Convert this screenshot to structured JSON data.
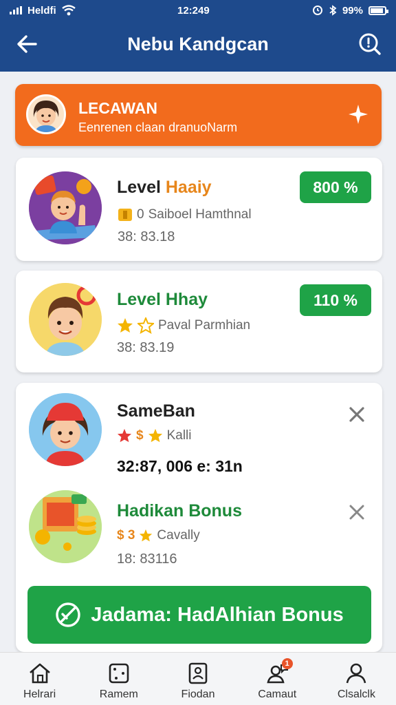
{
  "status_bar": {
    "carrier": "Heldfi",
    "time": "12:249",
    "battery": "99%"
  },
  "header": {
    "title": "Nebu Kandgcan"
  },
  "banner": {
    "title": "LECAWAN",
    "subtitle": "Eenrenen claan dranuoNarm"
  },
  "cards": [
    {
      "title_plain": "Level ",
      "title_accent": "Haaiy",
      "subtitle": "Saiboel Hamthnal",
      "subtitle_icon_text": "0",
      "time": "38: 83.18",
      "percent": "800 %"
    },
    {
      "title": "Level Hhay",
      "subtitle": "Paval Parmhian",
      "time": "38: 83.19",
      "percent": "110 %"
    }
  ],
  "list": [
    {
      "title": "SameBan",
      "subtitle_dollar": "$",
      "subtitle": "Kalli",
      "time": "32:87, 006 e: 31n"
    },
    {
      "title": "Hadikan Bonus",
      "subtitle_dollar": "$ 3",
      "subtitle": "Cavally",
      "time": "18: 83116"
    }
  ],
  "bonus_button": {
    "label": "Jadama: HadAlhian Bonus"
  },
  "bottom_nav": [
    {
      "label": "Helrari",
      "icon": "home-icon"
    },
    {
      "label": "Ramem",
      "icon": "dice-icon"
    },
    {
      "label": "Fiodan",
      "icon": "id-card-icon"
    },
    {
      "label": "Camaut",
      "icon": "user-chat-icon",
      "badge": "1"
    },
    {
      "label": "Clsalclk",
      "icon": "profile-icon"
    }
  ],
  "colors": {
    "header": "#1e4a8c",
    "banner": "#f26b1d",
    "green": "#1fa347",
    "accent_orange": "#e7861b"
  }
}
